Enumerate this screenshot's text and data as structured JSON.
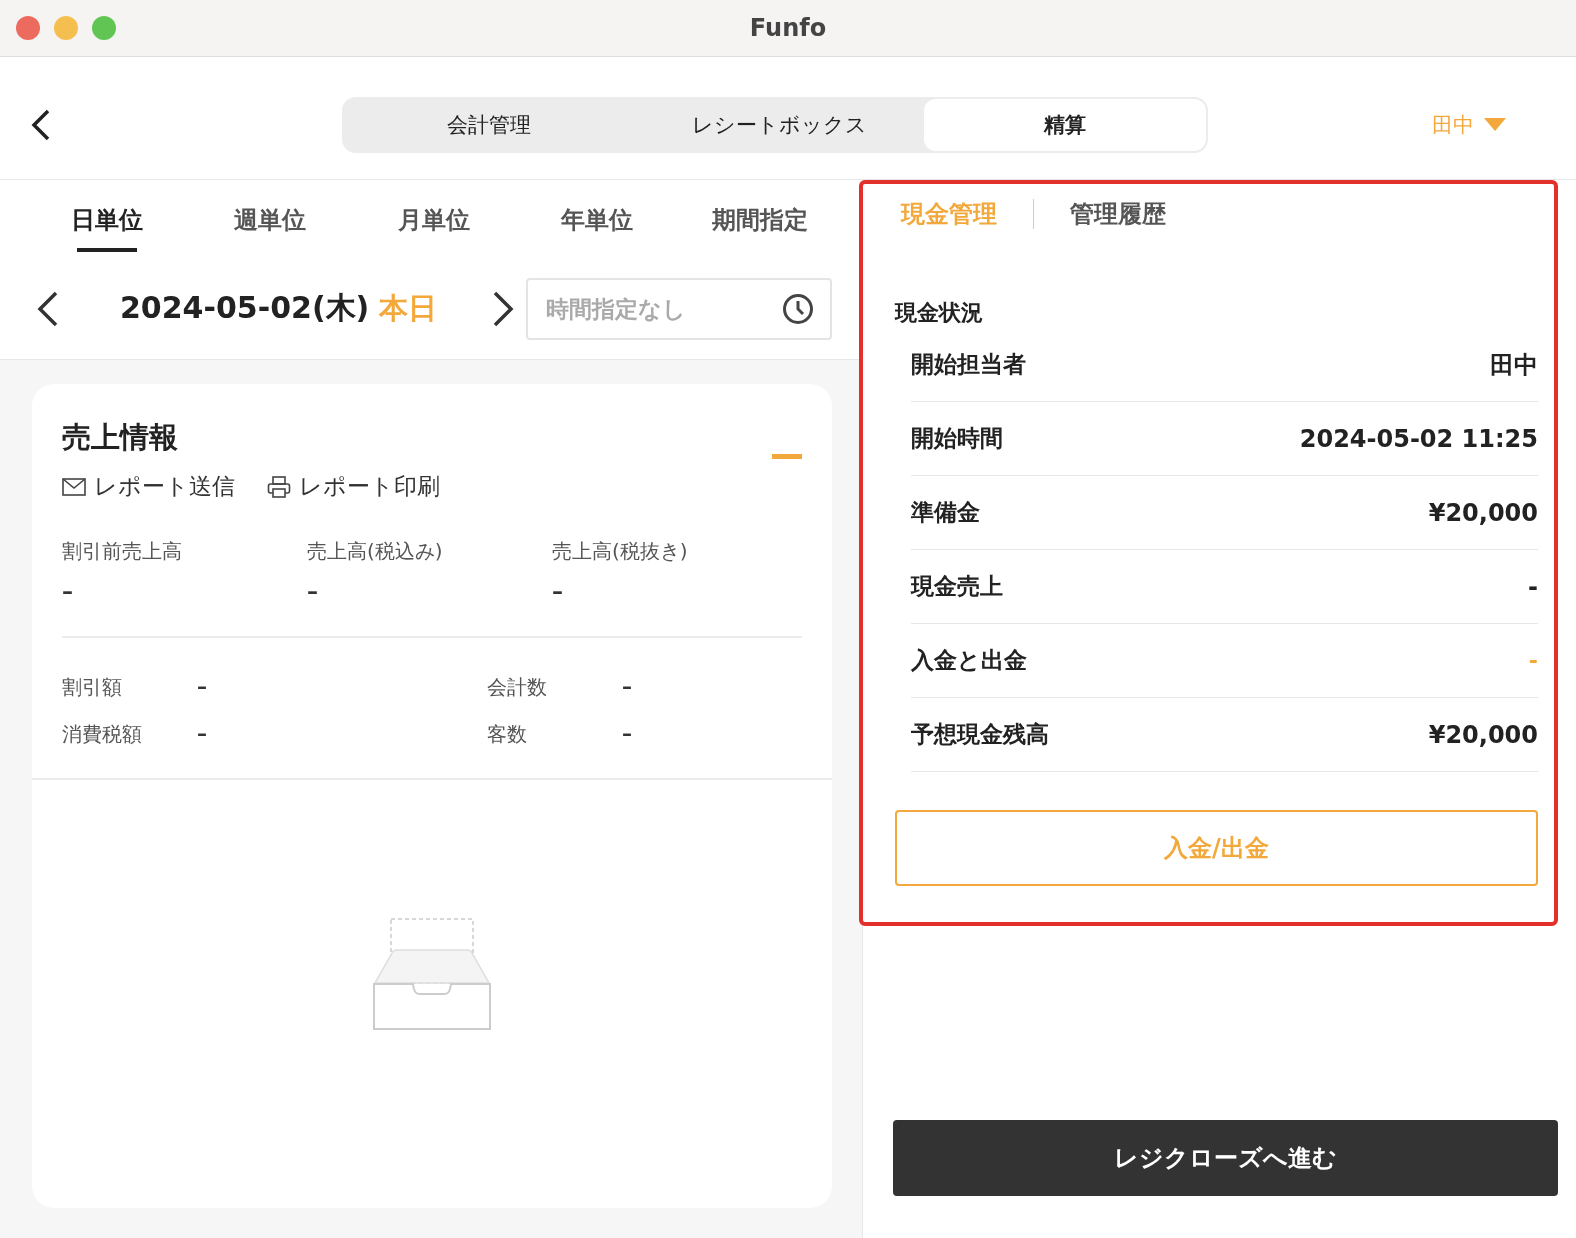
{
  "window": {
    "title": "Funfo"
  },
  "top_tabs": [
    {
      "label": "会計管理",
      "selected": false
    },
    {
      "label": "レシートボックス",
      "selected": false
    },
    {
      "label": "精算",
      "selected": true
    }
  ],
  "user": {
    "name": "田中"
  },
  "period_tabs": [
    {
      "label": "日単位",
      "selected": true
    },
    {
      "label": "週単位",
      "selected": false
    },
    {
      "label": "月単位",
      "selected": false
    },
    {
      "label": "年単位",
      "selected": false
    },
    {
      "label": "期間指定",
      "selected": false
    }
  ],
  "date": {
    "value": "2024-05-02(木)",
    "today": "本日"
  },
  "time_filter": {
    "placeholder": "時間指定なし"
  },
  "sales_card": {
    "title": "売上情報",
    "actions": [
      {
        "kind": "mail",
        "label": "レポート送信"
      },
      {
        "kind": "print",
        "label": "レポート印刷"
      }
    ],
    "metrics": [
      {
        "label": "割引前売上高",
        "value": "–"
      },
      {
        "label": "売上高(税込み)",
        "value": "–"
      },
      {
        "label": "売上高(税抜き)",
        "value": "–"
      }
    ],
    "stats": [
      {
        "label": "割引額",
        "value": "–"
      },
      {
        "label": "会計数",
        "value": "–"
      },
      {
        "label": "消費税額",
        "value": "–"
      },
      {
        "label": "客数",
        "value": "–"
      }
    ]
  },
  "cash_panel": {
    "tabs": [
      {
        "label": "現金管理",
        "selected": true
      },
      {
        "label": "管理履歴",
        "selected": false
      }
    ],
    "section_title": "現金状況",
    "rows": [
      {
        "label": "開始担当者",
        "value": "田中",
        "emphasis": false
      },
      {
        "label": "開始時間",
        "value": "2024-05-02 11:25",
        "emphasis": false
      },
      {
        "label": "準備金",
        "value": "¥20,000",
        "emphasis": false
      },
      {
        "label": "現金売上",
        "value": "-",
        "emphasis": false
      },
      {
        "label": "入金と出金",
        "value": "-",
        "emphasis": true
      },
      {
        "label": "予想現金残高",
        "value": "¥20,000",
        "emphasis": false
      }
    ],
    "action_button": "入金/出金"
  },
  "close_button": "レジクローズへ進む"
}
